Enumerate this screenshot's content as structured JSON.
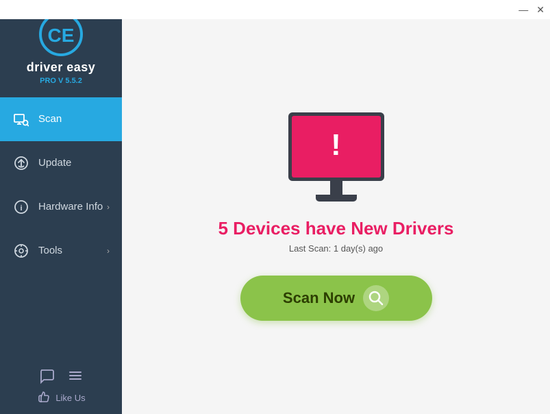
{
  "titlebar": {
    "minimize_label": "—",
    "close_label": "✕"
  },
  "sidebar": {
    "logo": {
      "app_name": "driver easy",
      "version": "PRO V 5.5.2"
    },
    "nav_items": [
      {
        "id": "scan",
        "label": "Scan",
        "active": true,
        "has_arrow": false
      },
      {
        "id": "update",
        "label": "Update",
        "active": false,
        "has_arrow": false
      },
      {
        "id": "hardware-info",
        "label": "Hardware Info",
        "active": false,
        "has_arrow": true
      },
      {
        "id": "tools",
        "label": "Tools",
        "active": false,
        "has_arrow": true
      }
    ],
    "bottom": {
      "like_us_label": "Like Us"
    }
  },
  "main": {
    "alert_title": "5 Devices have New Drivers",
    "alert_subtitle": "Last Scan: 1 day(s) ago",
    "scan_button_label": "Scan Now"
  }
}
